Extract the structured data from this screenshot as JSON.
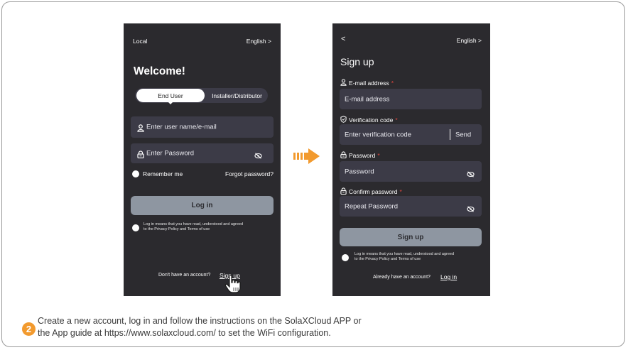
{
  "login": {
    "local": "Local",
    "language": "English >",
    "welcome": "Welcome!",
    "tabs": [
      "End User",
      "Installer/Distributor"
    ],
    "username_placeholder": "Enter user name/e-mail",
    "password_placeholder": "Enter Password",
    "remember_me": "Remember me",
    "forgot_password": "Forgot password?",
    "login_button": "Log in",
    "terms_line1": "Log in means that you have read, understood and agreed",
    "terms_line2": "to the Privacy Policy and Terms of use",
    "no_account": "Don't have an account?",
    "signup_link": "Sign up"
  },
  "signup": {
    "back": "<",
    "language": "English >",
    "title": "Sign up",
    "email_label": "E-mail address",
    "email_placeholder": "E-mail address",
    "code_label": "Verification code",
    "code_placeholder": "Enter verification code",
    "send": "Send",
    "password_label": "Password",
    "password_placeholder": "Password",
    "confirm_label": "Confirm password",
    "confirm_placeholder": "Repeat Password",
    "required_mark": "*",
    "signup_button": "Sign up",
    "terms_line1": "Log in means that you have read, understood and agreed",
    "terms_line2": "to the Privacy Policy and Terms of use",
    "have_account": "Already have an account?",
    "login_link": "Log in"
  },
  "step": {
    "number": "2",
    "line1": "Create a new account, log in and follow the instructions on the SolaXCloud APP or",
    "line2": "the App guide at https://www.solaxcloud.com/ to set the WiFi configuration."
  },
  "colors": {
    "phone_bg": "#2b2a2e",
    "field_bg": "#3c3b47",
    "button_bg": "#8e96a1",
    "arrow": "#f29a2e",
    "step_badge": "#f29a2e",
    "required": "#e0463e"
  }
}
